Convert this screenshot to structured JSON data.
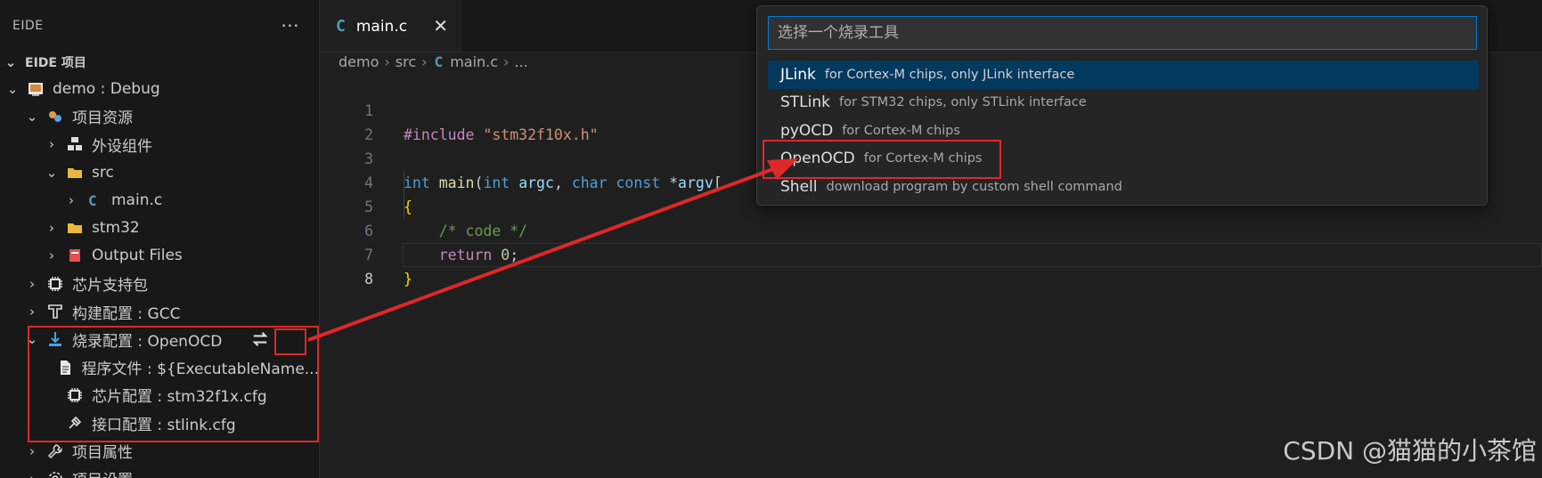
{
  "sidebar": {
    "title": "EIDE",
    "more": "···",
    "section_title": "EIDE 项目",
    "tree": [
      {
        "label": "demo : Debug",
        "icon": "project-icon",
        "chev": "⌄",
        "depth": 0
      },
      {
        "label": "项目资源",
        "icon": "resources-icon",
        "chev": "⌄",
        "depth": 1
      },
      {
        "label": "外设组件",
        "icon": "components-icon",
        "chev": "›",
        "depth": 2
      },
      {
        "label": "src",
        "icon": "folder-icon",
        "chev": "⌄",
        "depth": 2
      },
      {
        "label": "main.c",
        "icon": "c-file-icon",
        "chev": "›",
        "depth": 3
      },
      {
        "label": "stm32",
        "icon": "folder-icon",
        "chev": "›",
        "depth": 2
      },
      {
        "label": "Output Files",
        "icon": "output-icon",
        "chev": "›",
        "depth": 2
      },
      {
        "label": "芯片支持包",
        "icon": "chip-icon",
        "chev": "›",
        "depth": 1
      },
      {
        "label": "构建配置 : GCC",
        "icon": "build-icon",
        "chev": "›",
        "depth": 1
      },
      {
        "label": "烧录配置 : OpenOCD",
        "icon": "flash-icon",
        "chev": "⌄",
        "depth": 1,
        "action_icon": "switch-icon"
      },
      {
        "label": "程序文件 : ${ExecutableName...",
        "icon": "file-icon",
        "chev": "",
        "depth": 2
      },
      {
        "label": "芯片配置 : stm32f1x.cfg",
        "icon": "chip-icon",
        "chev": "",
        "depth": 2
      },
      {
        "label": "接口配置 : stlink.cfg",
        "icon": "plug-icon",
        "chev": "",
        "depth": 2
      },
      {
        "label": "项目属性",
        "icon": "wrench-icon",
        "chev": "›",
        "depth": 1
      },
      {
        "label": "项目设置",
        "icon": "gear-icon",
        "chev": "›",
        "depth": 1
      }
    ]
  },
  "tab": {
    "icon": "C",
    "label": "main.c",
    "close": "✕"
  },
  "breadcrumb": {
    "parts": [
      "demo",
      "src"
    ],
    "file": "main.c",
    "tail": "..."
  },
  "code": {
    "line_numbers": [
      "1",
      "2",
      "3",
      "4",
      "5",
      "6",
      "7",
      "8"
    ],
    "active_line": "8"
  },
  "quickpick": {
    "placeholder": "选择一个烧录工具",
    "items": [
      {
        "label": "JLink",
        "desc": "for Cortex-M chips, only JLink interface",
        "selected": true
      },
      {
        "label": "STLink",
        "desc": "for STM32 chips, only STLink interface",
        "selected": false
      },
      {
        "label": "pyOCD",
        "desc": "for Cortex-M chips",
        "selected": false
      },
      {
        "label": "OpenOCD",
        "desc": "for Cortex-M chips",
        "selected": false
      },
      {
        "label": "Shell",
        "desc": "download program by custom shell command",
        "selected": false
      }
    ]
  },
  "watermark": "CSDN @猫猫的小茶馆",
  "colors": {
    "annotation": "#e02828",
    "accent": "#0078d4",
    "selection": "#04395e"
  }
}
